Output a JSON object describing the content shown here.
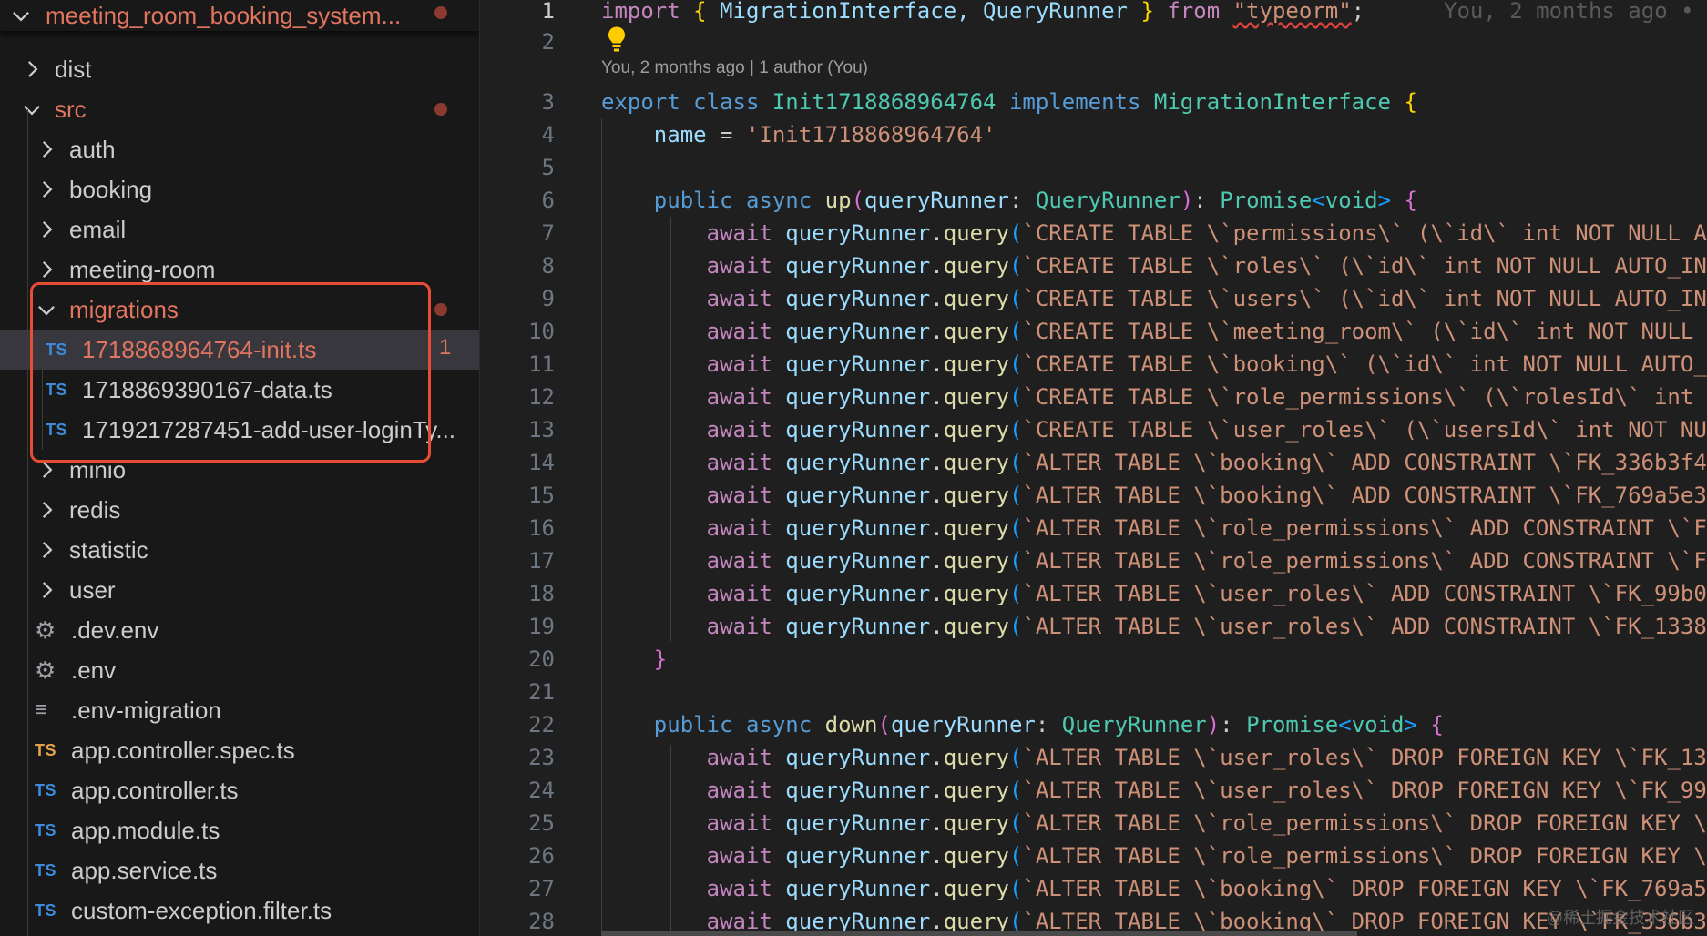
{
  "explorer": {
    "project_title": "meeting_room_booking_system...",
    "items": [
      {
        "label": "dist",
        "kind": "folder",
        "open": false
      },
      {
        "label": "src",
        "kind": "folder",
        "open": true,
        "modified": true
      },
      {
        "label": "auth",
        "kind": "folder",
        "open": false
      },
      {
        "label": "booking",
        "kind": "folder",
        "open": false
      },
      {
        "label": "email",
        "kind": "folder",
        "open": false
      },
      {
        "label": "meeting-room",
        "kind": "folder",
        "open": false
      },
      {
        "label": "migrations",
        "kind": "folder",
        "open": true,
        "modified": true
      },
      {
        "label": "1718868964764-init.ts",
        "kind": "ts",
        "modified": true,
        "problems": "1"
      },
      {
        "label": "1718869390167-data.ts",
        "kind": "ts"
      },
      {
        "label": "1719217287451-add-user-loginTy...",
        "kind": "ts"
      },
      {
        "label": "minio",
        "kind": "folder",
        "open": false
      },
      {
        "label": "redis",
        "kind": "folder",
        "open": false
      },
      {
        "label": "statistic",
        "kind": "folder",
        "open": false
      },
      {
        "label": "user",
        "kind": "folder",
        "open": false
      },
      {
        "label": ".dev.env",
        "kind": "settings"
      },
      {
        "label": ".env",
        "kind": "settings"
      },
      {
        "label": ".env-migration",
        "kind": "text"
      },
      {
        "label": "app.controller.spec.ts",
        "kind": "ts-spec"
      },
      {
        "label": "app.controller.ts",
        "kind": "ts"
      },
      {
        "label": "app.module.ts",
        "kind": "ts"
      },
      {
        "label": "app.service.ts",
        "kind": "ts"
      },
      {
        "label": "custom-exception.filter.ts",
        "kind": "ts"
      }
    ],
    "ts_badge": "TS",
    "settings_glyph": "⚙",
    "text_glyph": "≡"
  },
  "editor": {
    "codelens": "You, 2 months ago | 1 author (You)",
    "inline_blame": "You, 2 months ago •",
    "line_numbers": [
      "1",
      "2",
      "3",
      "4",
      "5",
      "6",
      "7",
      "8",
      "9",
      "10",
      "11",
      "12",
      "13",
      "14",
      "15",
      "16",
      "17",
      "18",
      "19",
      "20",
      "21",
      "22",
      "23",
      "24",
      "25",
      "26",
      "27",
      "28"
    ],
    "line1": {
      "import": "import",
      "open": "{",
      "names": " MigrationInterface, QueryRunner ",
      "close": "}",
      "from": "from",
      "module": "\"typeorm\"",
      "semi": ";"
    },
    "line3": {
      "export": "export",
      "class": "class",
      "name": "Init1718868964764",
      "implements": "implements",
      "iface": "MigrationInterface",
      "brace": "{"
    },
    "line4": {
      "prop": "name",
      "eq": " = ",
      "value": "'Init1718868964764'"
    },
    "up_sig": {
      "public": "public",
      "async": "async",
      "fn": "up",
      "param": "queryRunner",
      "type": "QueryRunner",
      "ret": "Promise",
      "void": "void",
      "brace": "{"
    },
    "down_sig": {
      "public": "public",
      "async": "async",
      "fn": "down",
      "param": "queryRunner",
      "type": "QueryRunner",
      "ret": "Promise",
      "void": "void",
      "brace": "{"
    },
    "close_brace": "}",
    "await": "await",
    "runner": "queryRunner",
    "query_fn": "query",
    "up_queries": [
      "`CREATE TABLE \\`permissions\\` (\\`id\\` int NOT NULL A",
      "`CREATE TABLE \\`roles\\` (\\`id\\` int NOT NULL AUTO_IN",
      "`CREATE TABLE \\`users\\` (\\`id\\` int NOT NULL AUTO_IN",
      "`CREATE TABLE \\`meeting_room\\` (\\`id\\` int NOT NULL ",
      "`CREATE TABLE \\`booking\\` (\\`id\\` int NOT NULL AUTO_",
      "`CREATE TABLE \\`role_permissions\\` (\\`rolesId\\` int ",
      "`CREATE TABLE \\`user_roles\\` (\\`usersId\\` int NOT NU",
      "`ALTER TABLE \\`booking\\` ADD CONSTRAINT \\`FK_336b3f4",
      "`ALTER TABLE \\`booking\\` ADD CONSTRAINT \\`FK_769a5e3",
      "`ALTER TABLE \\`role_permissions\\` ADD CONSTRAINT \\`F",
      "`ALTER TABLE \\`role_permissions\\` ADD CONSTRAINT \\`F",
      "`ALTER TABLE \\`user_roles\\` ADD CONSTRAINT \\`FK_99b0",
      "`ALTER TABLE \\`user_roles\\` ADD CONSTRAINT \\`FK_1338"
    ],
    "down_queries": [
      "`ALTER TABLE \\`user_roles\\` DROP FOREIGN KEY \\`FK_13",
      "`ALTER TABLE \\`user_roles\\` DROP FOREIGN KEY \\`FK_99",
      "`ALTER TABLE \\`role_permissions\\` DROP FOREIGN KEY \\",
      "`ALTER TABLE \\`role_permissions\\` DROP FOREIGN KEY \\",
      "`ALTER TABLE \\`booking\\` DROP FOREIGN KEY \\`FK_769a5",
      "`ALTER TABLE \\`booking\\` DROP FOREIGN KEY \\`FK_336b3"
    ],
    "watermark": "@稀土掘金技术社区"
  }
}
